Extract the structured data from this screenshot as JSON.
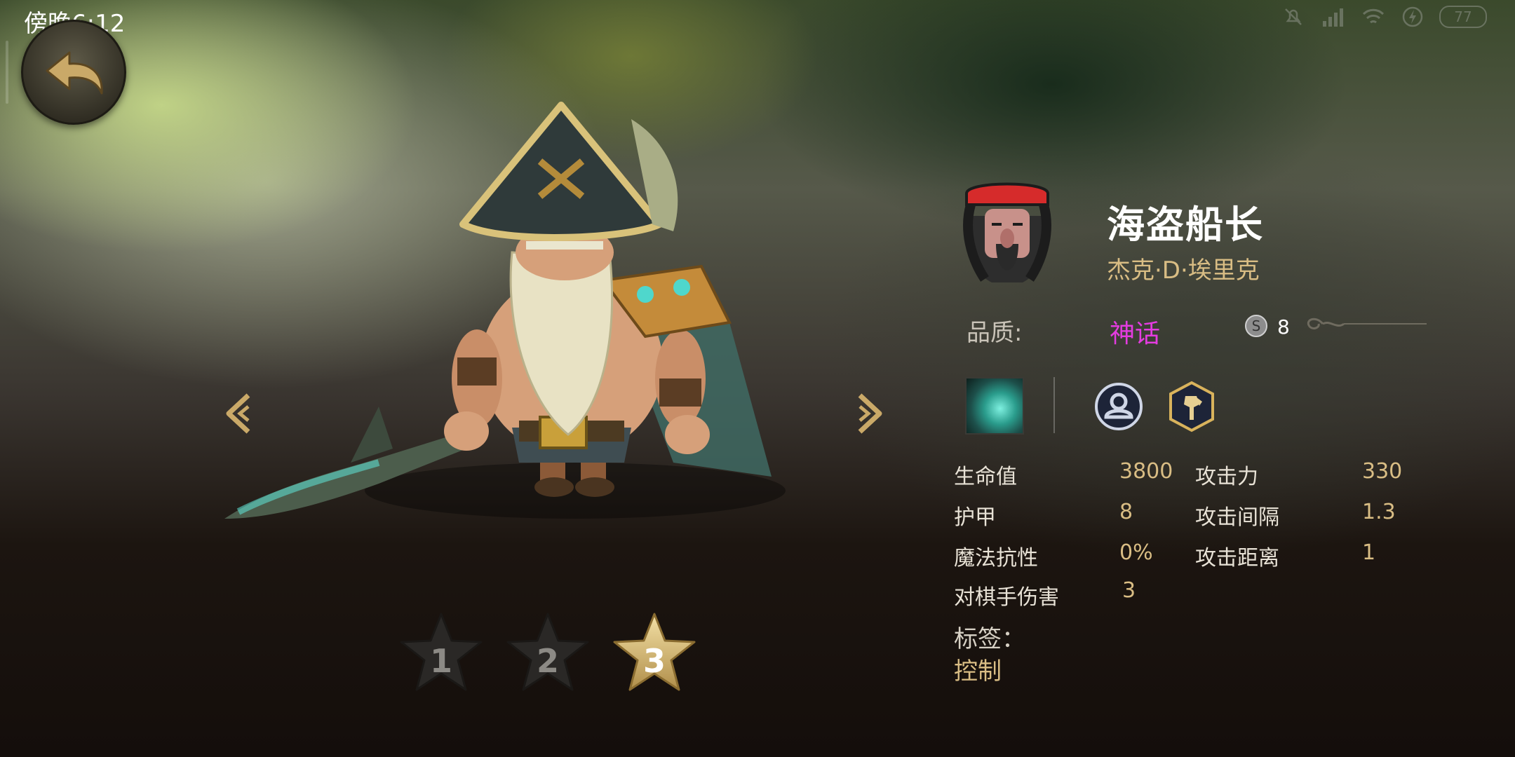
{
  "status": {
    "time": "傍晚6:12",
    "battery": "77"
  },
  "hero": {
    "name": "海盗船长",
    "subtitle": "杰克·D·埃里克",
    "quality_label": "品质:",
    "quality": "神话",
    "cost": "8"
  },
  "stars": [
    {
      "label": "1"
    },
    {
      "label": "2"
    },
    {
      "label": "3"
    }
  ],
  "selected_star": "3",
  "stats": {
    "hp_label": "生命值",
    "hp": "3800",
    "attack_label": "攻击力",
    "attack": "330",
    "armor_label": "护甲",
    "armor": "8",
    "attack_interval_label": "攻击间隔",
    "attack_interval": "1.3",
    "magic_resist_label": "魔法抗性",
    "magic_resist": "0%",
    "attack_range_label": "攻击距离",
    "attack_range": "1",
    "player_damage_label": "对棋手伤害",
    "player_damage": "3"
  },
  "tags": {
    "label": "标签：",
    "value": "控制"
  },
  "colors": {
    "quality_mythic": "#e43ce0",
    "accent_gold": "#d9bd84"
  }
}
